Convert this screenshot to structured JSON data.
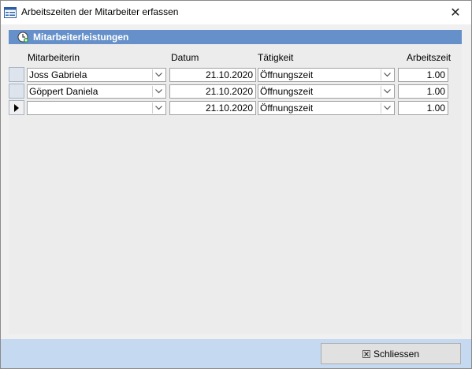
{
  "window": {
    "title": "Arbeitszeiten der Mitarbeiter erfassen",
    "title_icon": "form-icon",
    "close_glyph": "✕"
  },
  "subform": {
    "header": "Mitarbeiterleistungen",
    "header_icon": "clock-add-icon",
    "header_color": "#6590c9",
    "columns": {
      "employee": "Mitarbeiterin",
      "date": "Datum",
      "activity": "Tätigkeit",
      "hours": "Arbeitszeit"
    },
    "rows": [
      {
        "employee": "Joss Gabriela",
        "date": "21.10.2020",
        "activity": "Öffnungszeit",
        "hours": "1.00"
      },
      {
        "employee": "Göppert Daniela",
        "date": "21.10.2020",
        "activity": "Öffnungszeit",
        "hours": "1.00"
      },
      {
        "employee": "",
        "date": "21.10.2020",
        "activity": "Öffnungszeit",
        "hours": "1.00",
        "current": true
      }
    ]
  },
  "footer": {
    "close_label": "Schliessen",
    "close_icon": "close-x-icon",
    "background": "#c5d9f1"
  }
}
